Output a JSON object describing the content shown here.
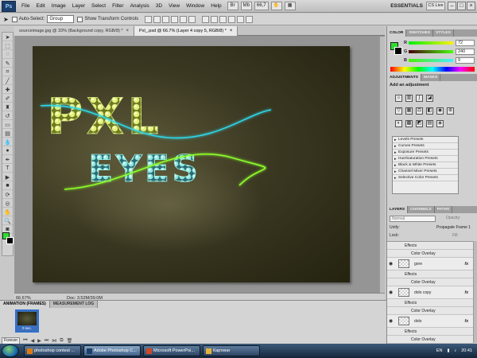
{
  "menubar": {
    "logo": "Ps",
    "items": [
      "File",
      "Edit",
      "Image",
      "Layer",
      "Select",
      "Filter",
      "Analysis",
      "3D",
      "View",
      "Window",
      "Help"
    ],
    "zoom_control": "66,7",
    "workspace": "ESSENTIALS",
    "cs_live": "CS Live",
    "window_buttons": [
      "–",
      "□",
      "×"
    ]
  },
  "options": {
    "auto_select_label": "Auto-Select:",
    "auto_select_value": "Group",
    "transform_label": "Show Transform Controls"
  },
  "tabs": [
    {
      "label": "sourceimage.jpg @ 33% (Background copy, RGB/8) *",
      "close": "×"
    },
    {
      "label": "Pxl_.psd @ 66.7% (Layer 4 copy 5, RGB/8) *",
      "close": "×"
    }
  ],
  "artwork": {
    "line1": "PXL",
    "line2": "EYES"
  },
  "status": {
    "zoom": "66.67%",
    "doc_size": "Doc: 3.52M/39.0M"
  },
  "animation": {
    "tabs": [
      "ANIMATION (FRAMES)",
      "MEASUREMENT LOG"
    ],
    "frame_delay": "0 sec.",
    "loop": "Forever"
  },
  "color_panel": {
    "tabs": [
      "COLOR",
      "SWATCHES",
      "STYLES"
    ],
    "channels": [
      {
        "letter": "R",
        "value": "72"
      },
      {
        "letter": "G",
        "value": "240"
      },
      {
        "letter": "B",
        "value": "9"
      }
    ]
  },
  "adjustments": {
    "tabs": [
      "ADJUSTMENTS",
      "MASKS"
    ],
    "title": "Add an adjustment",
    "presets": [
      "Levels Presets",
      "Curves Presets",
      "Exposure Presets",
      "Hue/Saturation Presets",
      "Black & White Presets",
      "Channel Mixer Presets",
      "Selective Color Presets"
    ]
  },
  "layers": {
    "tabs": [
      "LAYERS",
      "CHANNELS",
      "PATHS"
    ],
    "blend_mode": "Normal",
    "opacity_label": "Opacity:",
    "unify_label": "Unify:",
    "propagate_label": "Propagate Frame 1",
    "lock_label": "Lock:",
    "fill_label": "Fill:",
    "rows": [
      {
        "kind": "effects",
        "text": "Effects"
      },
      {
        "kind": "overlay",
        "text": "Color Overlay"
      },
      {
        "kind": "layer",
        "text": "gore",
        "fx": "fx"
      },
      {
        "kind": "effects",
        "text": "Effects"
      },
      {
        "kind": "overlay",
        "text": "Color Overlay"
      },
      {
        "kind": "layer",
        "text": "dolo copy",
        "fx": "fx"
      },
      {
        "kind": "effects",
        "text": "Effects"
      },
      {
        "kind": "overlay",
        "text": "Color Overlay"
      },
      {
        "kind": "layer",
        "text": "dolo",
        "fx": "fx"
      },
      {
        "kind": "effects",
        "text": "Effects"
      },
      {
        "kind": "overlay",
        "text": "Color Overlay"
      }
    ]
  },
  "taskbar": {
    "tasks": [
      {
        "label": "photoshop contest ...",
        "color": "#e07a10"
      },
      {
        "label": "Adobe Photoshop C...",
        "color": "#1d3f6b"
      },
      {
        "label": "Microsoft PowerPoi...",
        "color": "#d24726"
      },
      {
        "label": "Картини",
        "color": "#e3b53a"
      }
    ],
    "lang": "EN",
    "clock": "20:41"
  },
  "colors": {
    "foreground": "#2ede2e",
    "background": "#000000",
    "glow_cyan": "#2fd6e8",
    "glow_green": "#8cff2a"
  }
}
